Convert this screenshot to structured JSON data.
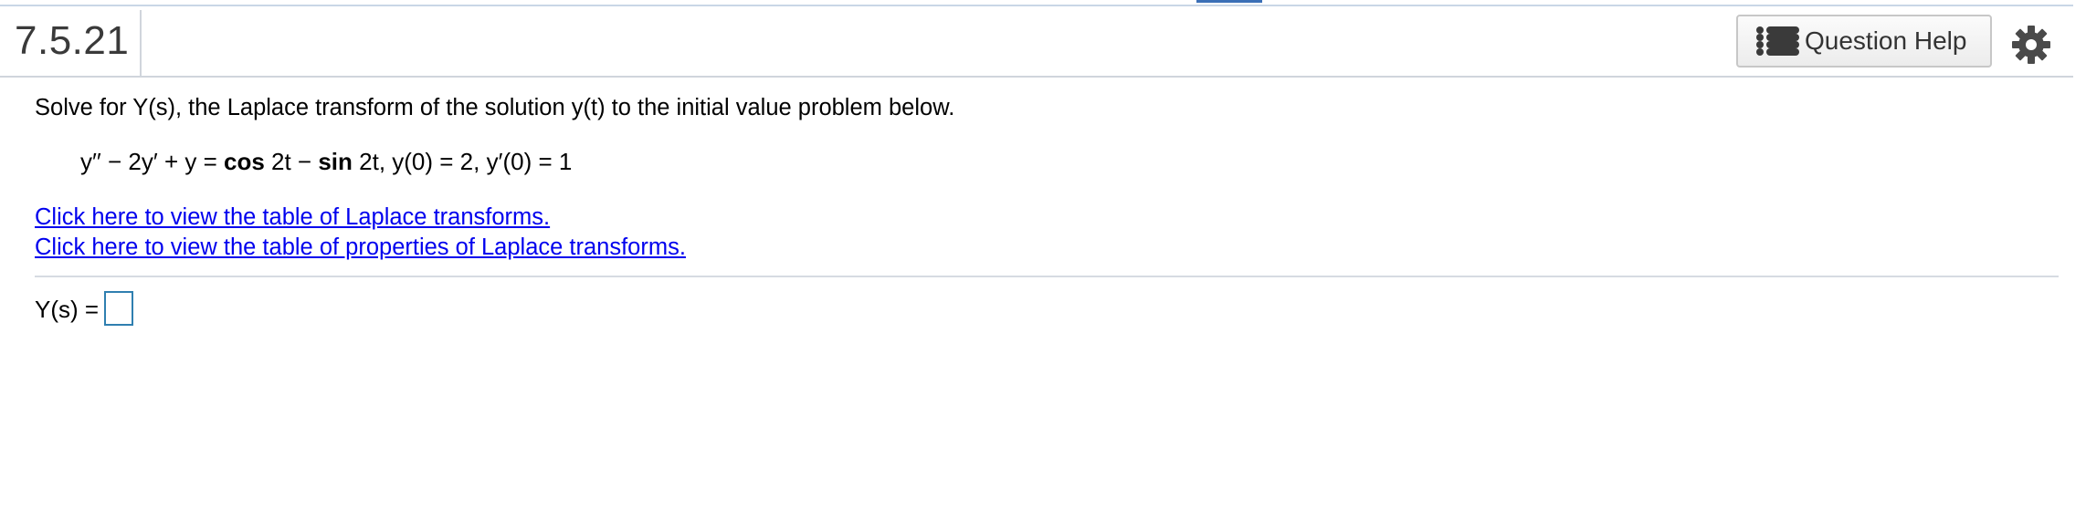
{
  "header": {
    "question_number": "7.5.21",
    "help_button_label": "Question Help",
    "help_icon": "list-icon",
    "settings_icon": "gear-icon"
  },
  "problem": {
    "prompt": "Solve for Y(s), the Laplace transform of the solution y(t) to the initial value problem below.",
    "equation": {
      "lhs": "y′′ − 2y′ + y = ",
      "cos_fn": "cos",
      "cos_arg": " 2t − ",
      "sin_fn": "sin",
      "sin_arg": " 2t, y(0) = 2, y′(0) = 1"
    },
    "links": {
      "laplace_table": "Click here to view the table of Laplace transforms.",
      "properties_table": "Click here to view the table of properties of Laplace transforms."
    }
  },
  "answer": {
    "label": "Y(s) =",
    "value": ""
  },
  "colors": {
    "link": "#0000ee",
    "answer_box_border": "#2f7fb0",
    "top_accent": "#3b6fb6"
  }
}
